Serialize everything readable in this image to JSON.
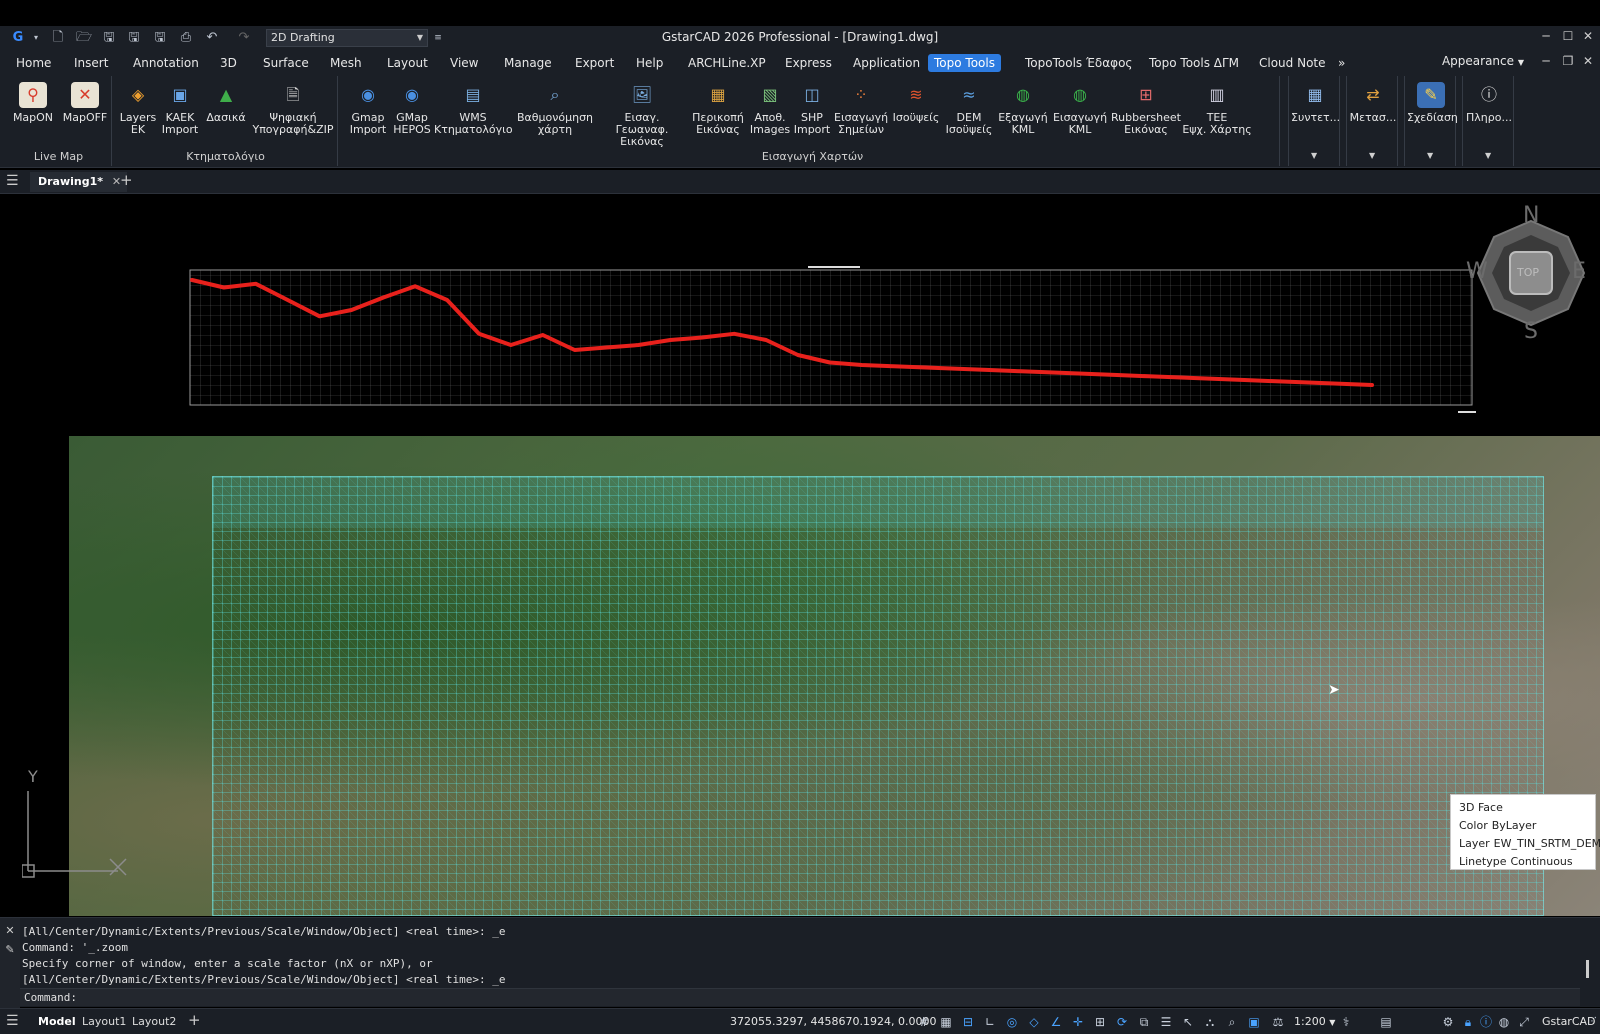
{
  "app": {
    "title": "GstarCAD 2026 Professional - [Drawing1.dwg]",
    "workspace": "2D Drafting",
    "appearance": "Appearance"
  },
  "menu": [
    "Home",
    "Insert",
    "Annotation",
    "3D",
    "Surface",
    "Mesh",
    "Layout",
    "View",
    "Manage",
    "Export",
    "Help",
    "ARCHLine.XP",
    "Express",
    "Application",
    "Topo Tools",
    "TopoTools Έδαφος",
    "Topo Tools ΔΓΜ",
    "Cloud Note"
  ],
  "menu_active": "Topo Tools",
  "ribbon": {
    "live_map": {
      "title": "Live Map",
      "mapon": "MapON",
      "mapoff": "MapOFF"
    },
    "ktimatologio": {
      "title": "Κτηματολόγιο",
      "layers_l1": "Layers",
      "layers_l2": "ΕΚ",
      "kaek_l1": "KAEK",
      "kaek_l2": "Import",
      "dasika": "Δασικά",
      "psifiaki_l1": "Ψηφιακή",
      "psifiaki_l2": "Υπογραφή&ZIP"
    },
    "eisagogi": {
      "title": "Εισαγωγή Χαρτών",
      "gmap_l1": "Gmap",
      "gmap_l2": "Import",
      "hepos_l1": "GMap",
      "hepos_l2": "HEPOS",
      "wms_l1": "WMS",
      "wms_l2": "Κτηματολόγιο",
      "vathm_l1": "Βαθμονόμηση",
      "vathm_l2": "χάρτη",
      "geo_l1": "Εισαγ. Γεωαναφ.",
      "geo_l2": "Εικόνας",
      "perik_l1": "Περικοπή",
      "perik_l2": "Εικόνας",
      "apoth_l1": "Αποθ.",
      "apoth_l2": "Images",
      "shp_l1": "SHP",
      "shp_l2": "Import",
      "simeia_l1": "Εισαγωγή",
      "simeia_l2": "Σημείων",
      "isoupsis": "Ισοϋψείς",
      "dem_l1": "DEM",
      "dem_l2": "Ισοϋψείς",
      "exag_l1": "Εξαγωγή",
      "exag_l2": "KML",
      "eisag_kml_l1": "Εισαγωγή",
      "eisag_kml_l2": "KML",
      "rubber_l1": "Rubbersheet",
      "rubber_l2": "Εικόνας",
      "tee_l1": "TEE",
      "tee_l2": "Εψχ. Χάρτης"
    },
    "syntet": "Συντετ...",
    "metas": "Μετασ...",
    "schediasi": "Σχεδίαση",
    "pliro": "Πληρο..."
  },
  "document_tab": "Drawing1*",
  "viewcube": {
    "n": "N",
    "s": "S",
    "e": "E",
    "w": "W",
    "top": "TOP"
  },
  "ucs": {
    "y": "Y"
  },
  "profile": {
    "values": [
      96,
      90,
      93,
      80,
      67,
      72,
      82,
      91,
      80,
      53,
      44,
      52,
      40,
      42,
      44,
      48,
      50,
      53,
      48,
      36,
      30,
      28,
      27,
      26,
      25,
      24,
      23,
      22,
      21,
      20,
      19,
      18,
      17,
      16,
      15,
      14,
      13,
      12
    ],
    "color": "#e8211c"
  },
  "tooltip": {
    "type": "3D Face",
    "color_label": "Color",
    "color_value": "ByLayer",
    "layer_label": "Layer",
    "layer_value": "EW_TIN_SRTM_DEM",
    "linetype_label": "Linetype",
    "linetype_value": "Continuous"
  },
  "command": {
    "history": [
      "[All/Center/Dynamic/Extents/Previous/Scale/Window/Object] <real time>: _e",
      "Command: '_.zoom",
      "Specify corner of window, enter a scale factor (nX or nXP), or",
      "[All/Center/Dynamic/Extents/Previous/Scale/Window/Object] <real time>: _e"
    ],
    "prompt": "Command:"
  },
  "status": {
    "tabs": [
      "Model",
      "Layout1",
      "Layout2"
    ],
    "coords": "372055.3297, 4458670.1924, 0.0000",
    "scale": "1:200",
    "brand": "GstarCAD"
  }
}
